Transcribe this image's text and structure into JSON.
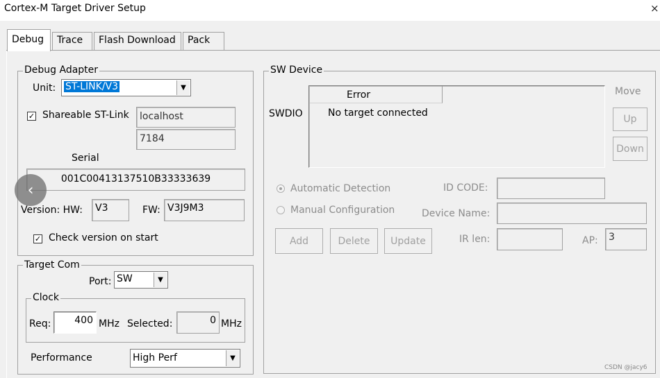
{
  "window": {
    "title": "Cortex-M Target Driver Setup",
    "close": "×"
  },
  "tabs": [
    {
      "label": "Debug",
      "active": true
    },
    {
      "label": "Trace",
      "active": false
    },
    {
      "label": "Flash Download",
      "active": false
    },
    {
      "label": "Pack",
      "active": false
    }
  ],
  "debug_adapter": {
    "group_label": "Debug Adapter",
    "unit_label": "Unit:",
    "unit_value": "ST-LINK/V3",
    "shareable_label": "Shareable ST-Link",
    "shareable_checked": true,
    "host": "localhost",
    "port": "7184",
    "serial_label": "Serial",
    "serial_value": "001C00413137510B33333639",
    "version_label": "Version: HW:",
    "hw_value": "V3",
    "fw_label": "FW:",
    "fw_value": "V3J9M3",
    "check_version_label": "Check version on start",
    "check_version_checked": true
  },
  "target_com": {
    "group_label": "Target Com",
    "port_label": "Port:",
    "port_value": "SW",
    "clock_label": "Clock",
    "req_label": "Req:",
    "req_value": "400",
    "mhz1": "MHz",
    "selected_label": "Selected:",
    "selected_value": "0",
    "mhz2": "MHz",
    "performance_label": "Performance",
    "performance_value": "High Perf"
  },
  "sw_device": {
    "group_label": "SW Device",
    "swdio_label": "SWDIO",
    "table_header": "Error",
    "table_row": "No target connected",
    "move_label": "Move",
    "up_button": "Up",
    "down_button": "Down",
    "auto_detect_label": "Automatic Detection",
    "manual_config_label": "Manual Configuration",
    "id_code_label": "ID CODE:",
    "device_name_label": "Device Name:",
    "ir_len_label": "IR len:",
    "ap_label": "AP:",
    "ap_value": "3",
    "add_button": "Add",
    "delete_button": "Delete",
    "update_button": "Update"
  },
  "overlay": {
    "nav_glyph": "‹",
    "watermark": "CSDN @jacy6"
  }
}
